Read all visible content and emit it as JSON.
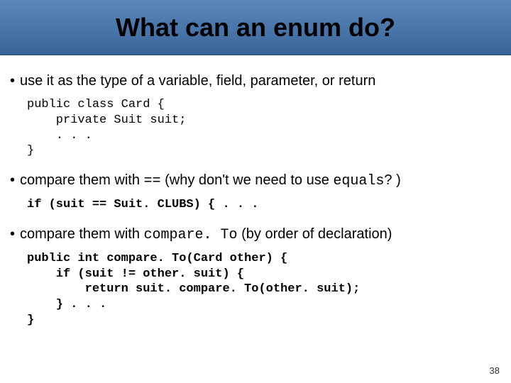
{
  "title": "What can an enum do?",
  "bullets": {
    "b1_pre": "use it as the type of a variable, field, parameter, or return",
    "b2_pre": "compare them with ",
    "b2_code": "==",
    "b2_mid": "  (why don't we need to use ",
    "b2_code2": "equals",
    "b2_post": "? )",
    "b3_pre": "compare them with ",
    "b3_code": "compare. To",
    "b3_post": "  (by order of declaration)"
  },
  "code": {
    "c1": "public class Card {\n    private Suit suit;\n    . . .\n}",
    "c2": "if (suit == Suit. CLUBS) { . . .",
    "c3": "public int compare. To(Card other) {\n    if (suit != other. suit) {\n        return suit. compare. To(other. suit);\n    } . . .\n}"
  },
  "page_number": "38"
}
